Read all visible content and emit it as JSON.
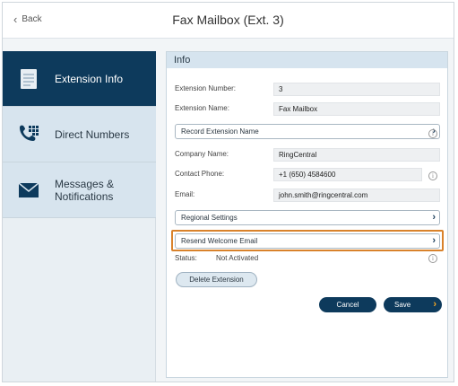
{
  "header": {
    "back_label": "Back",
    "title": "Fax Mailbox (Ext. 3)"
  },
  "sidebar": {
    "items": [
      {
        "label": "Extension Info",
        "icon": "document-icon",
        "active": true
      },
      {
        "label": "Direct Numbers",
        "icon": "phone-keypad-icon",
        "active": false
      },
      {
        "label": "Messages &",
        "label2": "Notifications",
        "icon": "envelope-icon",
        "active": false
      }
    ]
  },
  "info": {
    "heading": "Info",
    "fields": [
      {
        "label": "Extension Number:",
        "value": "3"
      },
      {
        "label": "Extension Name:",
        "value": "Fax Mailbox"
      },
      {
        "label": "Company Name:",
        "value": "RingCentral"
      },
      {
        "label": "Contact Phone:",
        "value": "+1 (650) 4584600"
      },
      {
        "label": "Email:",
        "value": "john.smith@ringcentral.com"
      }
    ],
    "record_name_label": "Record Extension Name",
    "regional_settings_label": "Regional Settings",
    "resend_email_label": "Resend Welcome Email",
    "status_label": "Status:",
    "status_value": "Not Activated",
    "delete_label": "Delete Extension",
    "cancel_label": "Cancel",
    "save_label": "Save",
    "info_icon_glyph": "i"
  },
  "colors": {
    "nav_active": "#0d3a5c",
    "highlight": "#d9822b",
    "save_arrow": "#f5a623"
  }
}
